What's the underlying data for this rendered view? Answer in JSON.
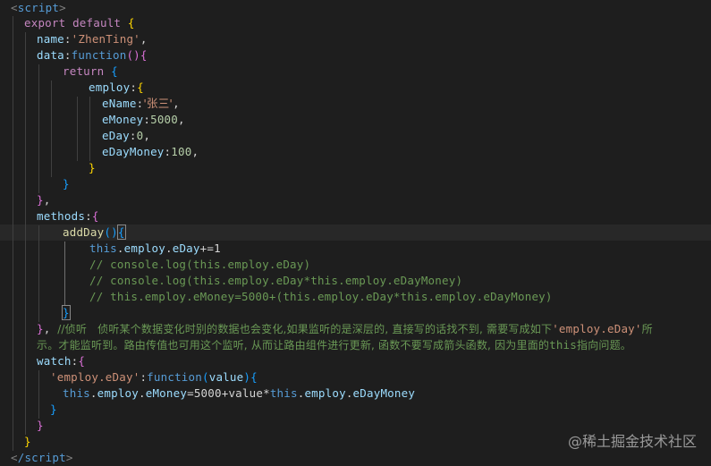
{
  "code": {
    "script_open": "script",
    "export_default": "export default",
    "name_key": "name",
    "name_value": "'ZhenTing'",
    "data_key": "data",
    "function_kw": "function",
    "return_kw": "return",
    "employ_key": "employ",
    "ename_key": "eName",
    "ename_value": "'张三'",
    "emoney_key": "eMoney",
    "emoney_value": "5000",
    "eday_key": "eDay",
    "eday_value": "0",
    "edaymoney_key": "eDayMoney",
    "edaymoney_value": "100",
    "methods_key": "methods",
    "addday_fn": "addDay",
    "this_kw": "this",
    "line_increment_rest": "+=1",
    "comment1": "// console.log(this.employ.eDay)",
    "comment2": "// console.log(this.employ.eDay*this.employ.eDayMoney)",
    "comment3": "// this.employ.eMoney=5000+(this.employ.eDay*this.employ.eDayMoney)",
    "comment_long_a": "//侦听   侦听某个数据变化时别的数据也会变化,如果监听的是深层的, 直接写的话找不到, 需要写成如下",
    "comment_long_str": "'employ.eDay'",
    "comment_long_b": "所",
    "comment_long_c": "示。才能监听到。路由传值也可用这个监听, 从而让路由组件进行更新, 函数不要写成箭头函数, 因为里面的",
    "comment_long_this": "this",
    "comment_long_d": "指向问题。",
    "watch_key": "watch",
    "watch_prop": "'employ.eDay'",
    "watch_param": "value",
    "watch_body_rest": "=5000+value*",
    "script_close": "/script"
  },
  "watermark": "@稀土掘金技术社区"
}
